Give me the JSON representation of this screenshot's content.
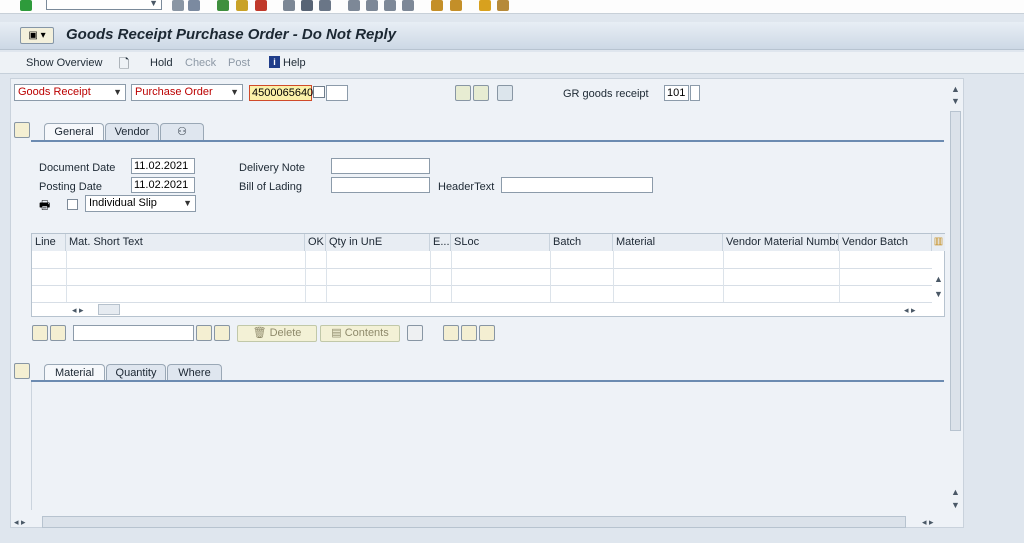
{
  "window": {
    "title": "Goods Receipt Purchase Order - Do Not Reply"
  },
  "toolbar": {
    "show_overview": "Show Overview",
    "hold": "Hold",
    "check": "Check",
    "post": "Post",
    "help": "Help"
  },
  "header": {
    "transaction": "Goods Receipt",
    "reference": "Purchase Order",
    "po_number": "4500065640",
    "movement_label": "GR goods receipt",
    "movement_type": "101"
  },
  "tabs": {
    "general": "General",
    "vendor": "Vendor"
  },
  "general": {
    "document_date_label": "Document Date",
    "document_date": "11.02.2021",
    "posting_date_label": "Posting Date",
    "posting_date": "11.02.2021",
    "delivery_note_label": "Delivery Note",
    "bill_of_lading_label": "Bill of Lading",
    "header_text_label": "HeaderText",
    "print_option": "Individual Slip"
  },
  "grid": {
    "columns": [
      "Line",
      "Mat. Short Text",
      "OK",
      "Qty in UnE",
      "E...",
      "SLoc",
      "Batch",
      "Material",
      "Vendor Material Number",
      "Vendor Batch"
    ]
  },
  "item_toolbar": {
    "delete": "Delete",
    "contents": "Contents"
  },
  "detail_tabs": {
    "material": "Material",
    "quantity": "Quantity",
    "where": "Where"
  }
}
